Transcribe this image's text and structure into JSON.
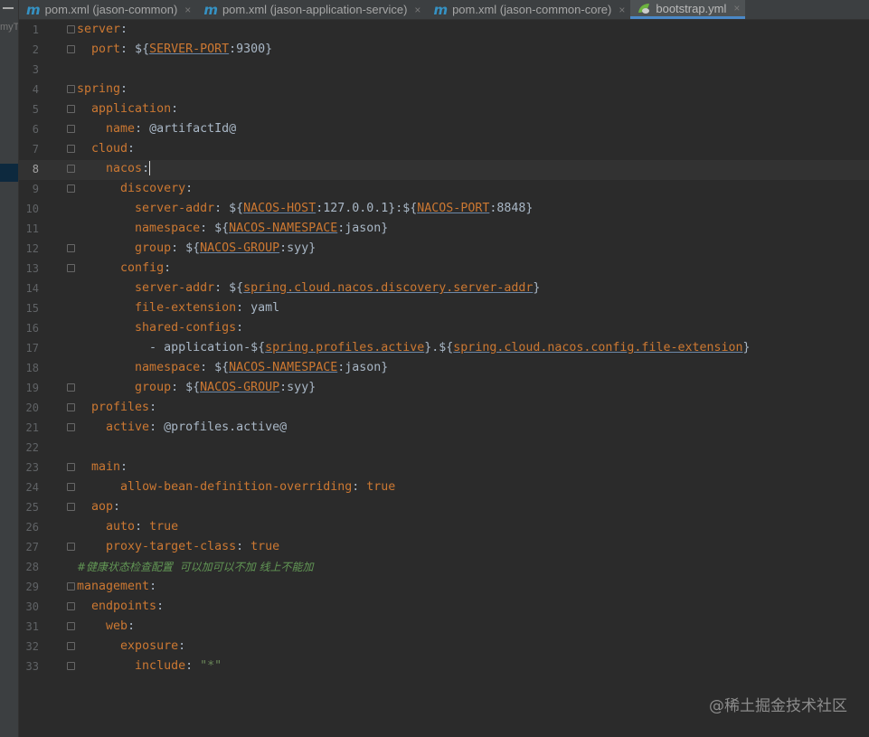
{
  "sidebar": {
    "project_label": "myT"
  },
  "tabs": [
    {
      "label": "pom.xml (jason-common)",
      "icon": "maven-icon",
      "active": false
    },
    {
      "label": "pom.xml (jason-application-service)",
      "icon": "maven-icon",
      "active": false
    },
    {
      "label": "pom.xml (jason-common-core)",
      "icon": "maven-icon",
      "active": false
    },
    {
      "label": "bootstrap.yml",
      "icon": "spring-leaf-icon",
      "active": true
    }
  ],
  "icons": {
    "maven": "m",
    "close": "×"
  },
  "editor": {
    "current_line": 8,
    "lines": [
      [
        [
          "k",
          "server"
        ],
        [
          "t",
          ":"
        ]
      ],
      [
        [
          "t",
          "  "
        ],
        [
          "k",
          "port"
        ],
        [
          "t",
          ": ${"
        ],
        [
          "p",
          "SERVER-PORT"
        ],
        [
          "t",
          ":9300}"
        ]
      ],
      [],
      [
        [
          "k",
          "spring"
        ],
        [
          "t",
          ":"
        ]
      ],
      [
        [
          "t",
          "  "
        ],
        [
          "k",
          "application"
        ],
        [
          "t",
          ":"
        ]
      ],
      [
        [
          "t",
          "    "
        ],
        [
          "k",
          "name"
        ],
        [
          "t",
          ": @artifactId@"
        ]
      ],
      [
        [
          "t",
          "  "
        ],
        [
          "k",
          "cloud"
        ],
        [
          "t",
          ":"
        ]
      ],
      [
        [
          "t",
          "    "
        ],
        [
          "k",
          "nacos"
        ],
        [
          "t",
          ":"
        ]
      ],
      [
        [
          "t",
          "      "
        ],
        [
          "k",
          "discovery"
        ],
        [
          "t",
          ":"
        ]
      ],
      [
        [
          "t",
          "        "
        ],
        [
          "k",
          "server-addr"
        ],
        [
          "t",
          ": ${"
        ],
        [
          "p",
          "NACOS-HOST"
        ],
        [
          "t",
          ":127.0.0.1}:${"
        ],
        [
          "p",
          "NACOS-PORT"
        ],
        [
          "t",
          ":8848}"
        ]
      ],
      [
        [
          "t",
          "        "
        ],
        [
          "k",
          "namespace"
        ],
        [
          "t",
          ": ${"
        ],
        [
          "p",
          "NACOS-NAMESPACE"
        ],
        [
          "t",
          ":jason}"
        ]
      ],
      [
        [
          "t",
          "        "
        ],
        [
          "k",
          "group"
        ],
        [
          "t",
          ": ${"
        ],
        [
          "p",
          "NACOS-GROUP"
        ],
        [
          "t",
          ":syy}"
        ]
      ],
      [
        [
          "t",
          "      "
        ],
        [
          "k",
          "config"
        ],
        [
          "t",
          ":"
        ]
      ],
      [
        [
          "t",
          "        "
        ],
        [
          "k",
          "server-addr"
        ],
        [
          "t",
          ": ${"
        ],
        [
          "p",
          "spring.cloud.nacos.discovery.server-addr"
        ],
        [
          "t",
          "}"
        ]
      ],
      [
        [
          "t",
          "        "
        ],
        [
          "k",
          "file-extension"
        ],
        [
          "t",
          ": yaml"
        ]
      ],
      [
        [
          "t",
          "        "
        ],
        [
          "k",
          "shared-configs"
        ],
        [
          "t",
          ":"
        ]
      ],
      [
        [
          "t",
          "          - application-${"
        ],
        [
          "p",
          "spring.profiles.active"
        ],
        [
          "t",
          "}.${"
        ],
        [
          "p",
          "spring.cloud.nacos.config.file-extension"
        ],
        [
          "t",
          "}"
        ]
      ],
      [
        [
          "t",
          "        "
        ],
        [
          "k",
          "namespace"
        ],
        [
          "t",
          ": ${"
        ],
        [
          "p",
          "NACOS-NAMESPACE"
        ],
        [
          "t",
          ":jason}"
        ]
      ],
      [
        [
          "t",
          "        "
        ],
        [
          "k",
          "group"
        ],
        [
          "t",
          ": ${"
        ],
        [
          "p",
          "NACOS-GROUP"
        ],
        [
          "t",
          ":syy}"
        ]
      ],
      [
        [
          "t",
          "  "
        ],
        [
          "k",
          "profiles"
        ],
        [
          "t",
          ":"
        ]
      ],
      [
        [
          "t",
          "    "
        ],
        [
          "k",
          "active"
        ],
        [
          "t",
          ": @profiles.active@"
        ]
      ],
      [],
      [
        [
          "t",
          "  "
        ],
        [
          "k",
          "main"
        ],
        [
          "t",
          ":"
        ]
      ],
      [
        [
          "t",
          "      "
        ],
        [
          "k",
          "allow-bean-definition-overriding"
        ],
        [
          "t",
          ": "
        ],
        [
          "k",
          "true"
        ]
      ],
      [
        [
          "t",
          "  "
        ],
        [
          "k",
          "aop"
        ],
        [
          "t",
          ":"
        ]
      ],
      [
        [
          "t",
          "    "
        ],
        [
          "k",
          "auto"
        ],
        [
          "t",
          ": "
        ],
        [
          "k",
          "true"
        ]
      ],
      [
        [
          "t",
          "    "
        ],
        [
          "k",
          "proxy-target-class"
        ],
        [
          "t",
          ": "
        ],
        [
          "k",
          "true"
        ]
      ],
      [
        [
          "c",
          "#健康状态检查配置  可以加可以不加 线上不能加"
        ]
      ],
      [
        [
          "k",
          "management"
        ],
        [
          "t",
          ":"
        ]
      ],
      [
        [
          "t",
          "  "
        ],
        [
          "k",
          "endpoints"
        ],
        [
          "t",
          ":"
        ]
      ],
      [
        [
          "t",
          "    "
        ],
        [
          "k",
          "web"
        ],
        [
          "t",
          ":"
        ]
      ],
      [
        [
          "t",
          "      "
        ],
        [
          "k",
          "exposure"
        ],
        [
          "t",
          ":"
        ]
      ],
      [
        [
          "t",
          "        "
        ],
        [
          "k",
          "include"
        ],
        [
          "t",
          ": "
        ],
        [
          "s",
          "\"*\""
        ]
      ]
    ]
  },
  "watermark": "@稀土掘金技术社区"
}
